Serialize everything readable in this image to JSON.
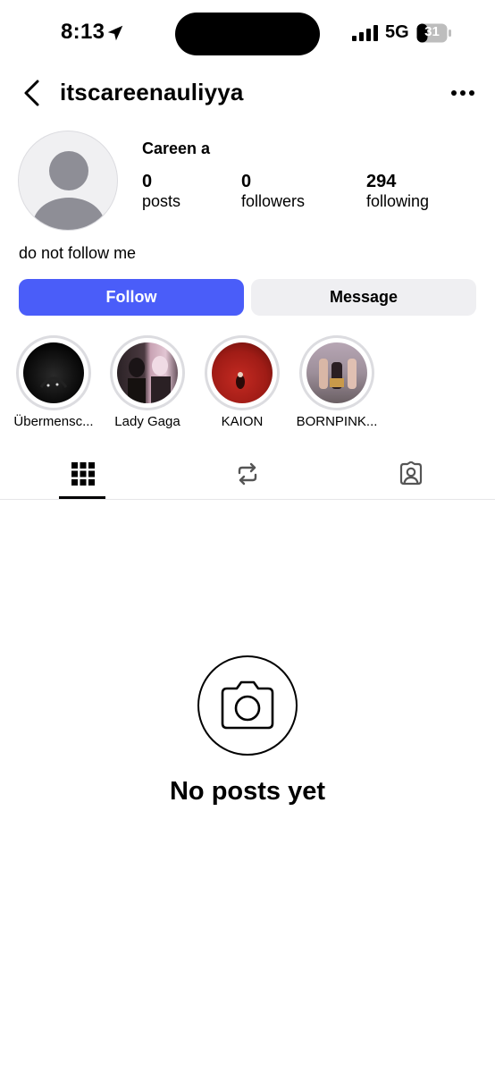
{
  "status_bar": {
    "time": "8:13",
    "network": "5G",
    "battery": "31",
    "icons": [
      "location-arrow-icon",
      "signal-bars-icon",
      "battery-icon"
    ]
  },
  "header": {
    "username": "itscareenauliyya",
    "back_icon": "chevron-left-icon",
    "more_icon": "ellipsis-icon"
  },
  "profile": {
    "full_name": "Careen a",
    "stats": [
      {
        "value": "0",
        "label": "posts"
      },
      {
        "value": "0",
        "label": "followers"
      },
      {
        "value": "294",
        "label": "following"
      }
    ],
    "bio": "do not follow me"
  },
  "actions": {
    "follow_label": "Follow",
    "message_label": "Message"
  },
  "highlights": [
    {
      "label": "Übermensc..."
    },
    {
      "label": "Lady Gaga"
    },
    {
      "label": "KAION"
    },
    {
      "label": "BORNPINK..."
    }
  ],
  "tabs": [
    {
      "icon": "grid-icon",
      "active": true
    },
    {
      "icon": "repost-icon",
      "active": false
    },
    {
      "icon": "tagged-person-icon",
      "active": false
    }
  ],
  "empty_state": {
    "icon": "camera-icon",
    "title": "No posts yet"
  },
  "colors": {
    "accent": "#4a5df9",
    "secondary_button": "#efeff2",
    "divider": "#e6e6e8"
  }
}
